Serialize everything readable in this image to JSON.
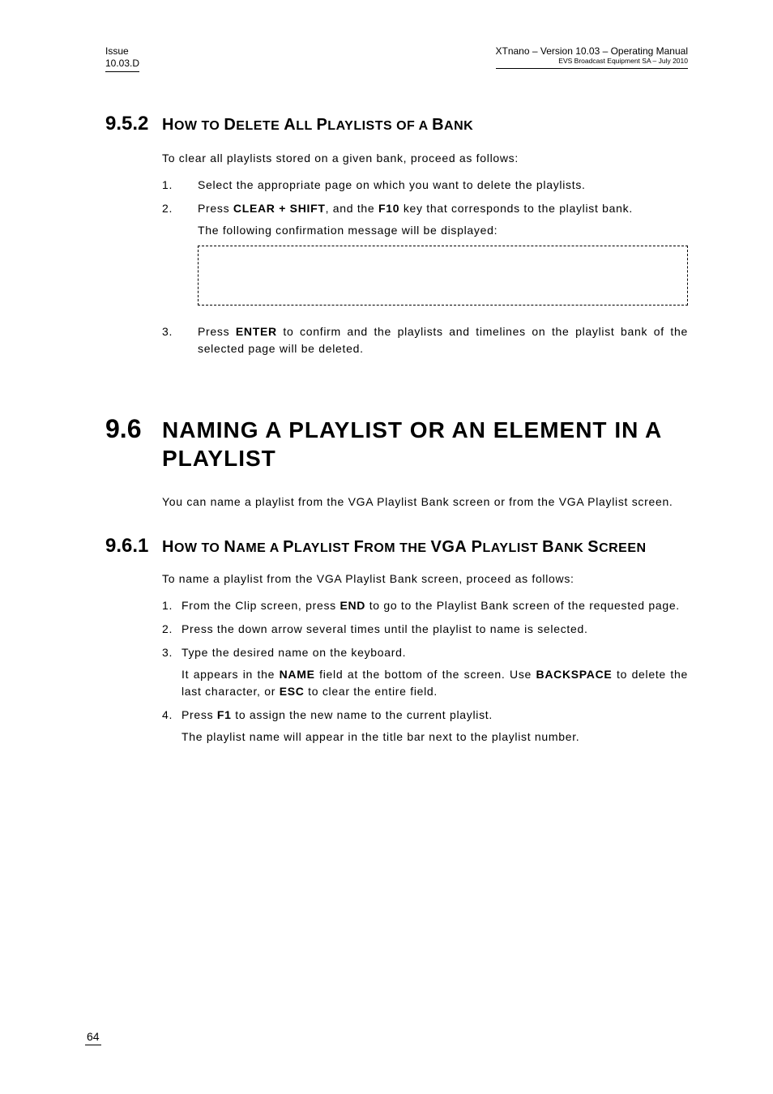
{
  "header": {
    "left_line1": "Issue",
    "left_line2": "10.03.D",
    "right_line1": "XTnano – Version 10.03 – Operating Manual",
    "right_line2": "EVS Broadcast Equipment SA – July 2010"
  },
  "s952": {
    "num": "9.5.2",
    "title_pre": "H",
    "title_sc1": "OW TO ",
    "title_b2": "D",
    "title_sc2": "ELETE ",
    "title_b3": "A",
    "title_sc3": "LL ",
    "title_b4": "P",
    "title_sc4": "LAYLISTS OF A ",
    "title_b5": "B",
    "title_sc5": "ANK",
    "intro": "To clear all playlists stored on a given bank, proceed as follows:",
    "li1": "Select the appropriate page on which you want to delete the playlists.",
    "li2a": "Press ",
    "li2key1": "CLEAR + SHIFT",
    "li2b": ", and the ",
    "li2key2": "F10",
    "li2c": " key that corresponds to the playlist bank.",
    "li2sub": "The following confirmation message will be displayed:",
    "li3a": "Press ",
    "li3key": "ENTER",
    "li3b": " to confirm and the playlists and timelines on the playlist bank of the selected page will be deleted."
  },
  "s96": {
    "num": "9.6",
    "title": "NAMING A PLAYLIST OR AN ELEMENT IN A PLAYLIST",
    "para": "You can name a playlist from the VGA Playlist Bank screen or from the VGA Playlist screen."
  },
  "s961": {
    "num": "9.6.1",
    "t_b1": "H",
    "t_s1": "OW TO ",
    "t_b2": "N",
    "t_s2": "AME A ",
    "t_b3": "P",
    "t_s3": "LAYLIST ",
    "t_b4": "F",
    "t_s4": "ROM THE ",
    "t_b5": "VGA P",
    "t_s5": "LAYLIST ",
    "t_b6": "B",
    "t_s6": "ANK ",
    "t_b7": "S",
    "t_s7": "CREEN",
    "intro": "To name a playlist from the VGA Playlist Bank screen, proceed as follows:",
    "li1a": "From the Clip screen, press ",
    "li1k": "END",
    "li1b": " to go to the Playlist Bank screen of the requested page.",
    "li2": "Press the down arrow several times until the playlist to name is selected.",
    "li3": "Type the desired name on the keyboard.",
    "li3sub_a": "It appears in the ",
    "li3sub_k1": "NAME",
    "li3sub_b": " field at the bottom of the screen. Use ",
    "li3sub_k2": "BACKSPACE",
    "li3sub_c": " to delete the last character, or ",
    "li3sub_k3": "ESC",
    "li3sub_d": " to clear the entire field.",
    "li4a": "Press ",
    "li4k": "F1",
    "li4b": " to assign the new name to the current playlist.",
    "li4sub": "The playlist name will appear in the title bar next to the playlist number."
  },
  "footer": {
    "page": "64"
  }
}
